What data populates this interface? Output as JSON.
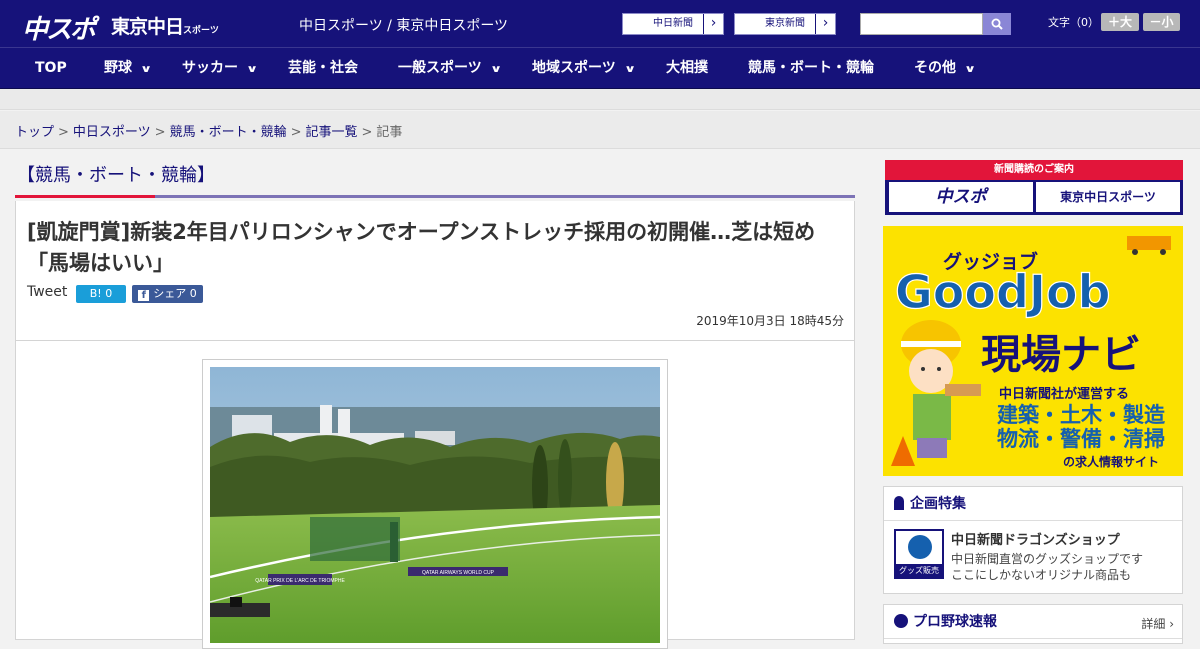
{
  "header": {
    "logo_chuspo": "中スポ",
    "logo_tokyo": "東京中日",
    "logo_tokyo_small": "スポーツ",
    "sites": "中日スポーツ / 東京中日スポーツ",
    "paper_buttons": [
      "中日新聞",
      "東京新聞"
    ],
    "font_size_label": "文字（0）",
    "font_bigger": "＋大",
    "font_smaller": "－小"
  },
  "nav": {
    "items": [
      {
        "label": "TOP",
        "dropdown": false
      },
      {
        "label": "野球",
        "dropdown": true
      },
      {
        "label": "サッカー",
        "dropdown": true
      },
      {
        "label": "芸能・社会",
        "dropdown": false
      },
      {
        "label": "一般スポーツ",
        "dropdown": true
      },
      {
        "label": "地域スポーツ",
        "dropdown": true
      },
      {
        "label": "大相撲",
        "dropdown": false
      },
      {
        "label": "競馬・ボート・競輪",
        "dropdown": false
      },
      {
        "label": "その他",
        "dropdown": true
      }
    ]
  },
  "breadcrumb": [
    "トップ",
    "中日スポーツ",
    "競馬・ボート・競輪",
    "記事一覧",
    "記事"
  ],
  "category_title": "【競馬・ボート・競輪】",
  "article": {
    "title": "[凱旋門賞]新装2年目パリロンシャンでオープンストレッチ採用の初開催…芝は短め「馬場はいい」",
    "tweet_label": "Tweet",
    "hatena_label": "B! 0",
    "facebook_label": "シェア 0",
    "date": "2019年10月3日 18時45分",
    "photo_sign_1": "QATAR AIRWAYS WORLD CUP",
    "photo_sign_2": "QATAR PRIX DE L'ARC DE TRIOMPHE"
  },
  "sidebar": {
    "subscribe_head": "新聞購読のご案内",
    "subscribe_buttons": [
      "中スポ",
      "東京中日スポーツ"
    ],
    "ad": {
      "kana": "グッジョブ",
      "brand": "GoodJob",
      "tagline": "現場ナビ",
      "line1": "中日新聞社が運営する",
      "line2": "建築・土木・製造",
      "line3": "物流・警備・清掃",
      "line4": "の求人情報サイト"
    },
    "feature": {
      "heading": "企画特集",
      "item_title": "中日新聞ドラゴンズショップ",
      "item_desc_1": "中日新聞直営のグッズショップです",
      "item_desc_2": "ここにしかないオリジナル商品も",
      "thumb_label": "グッズ販売中"
    },
    "baseball": {
      "heading": "プロ野球速報",
      "detail": "詳細 ›"
    }
  },
  "colors": {
    "brand_navy": "#16127a",
    "accent_red": "#e2153a",
    "ad_yellow": "#fce200"
  }
}
